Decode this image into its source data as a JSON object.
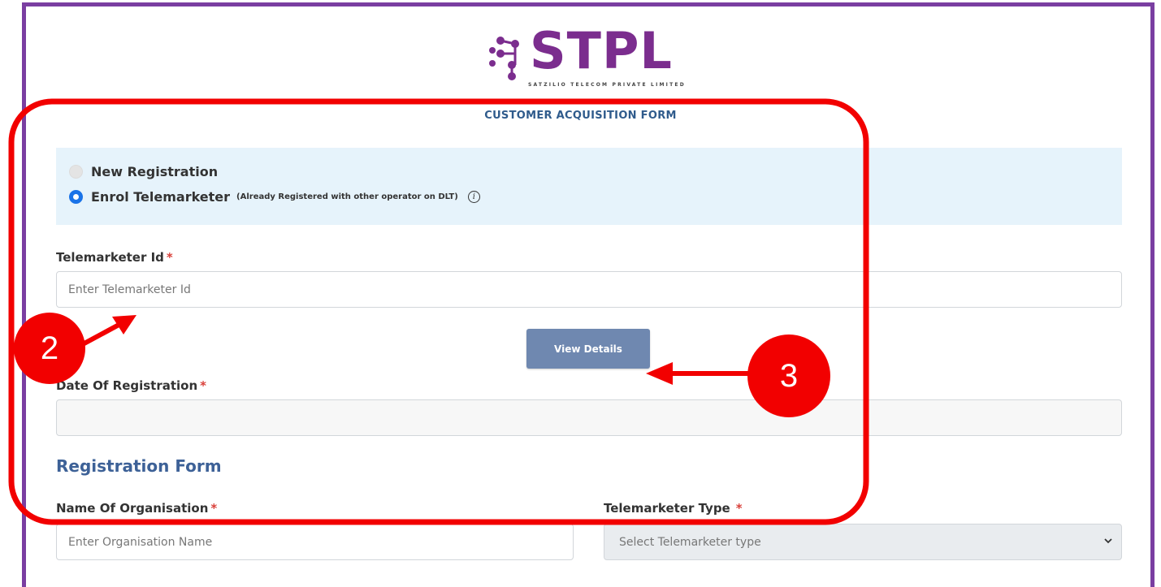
{
  "logo": {
    "brand": "STPL",
    "tagline": "SATZILIO TELECOM PRIVATE LIMITED",
    "brand_color": "#7b2d8e"
  },
  "form_title": "CUSTOMER ACQUISITION FORM",
  "registration_options": [
    {
      "label": "New Registration",
      "selected": false
    },
    {
      "label": "Enrol Telemarketer",
      "note": "(Already Registered with other operator on DLT)",
      "selected": true
    }
  ],
  "fields": {
    "telemarketer_id": {
      "label": "Telemarketer Id",
      "required": "*",
      "placeholder": "Enter Telemarketer Id"
    },
    "date_of_registration": {
      "label": "Date Of Registration",
      "required": "*",
      "value": ""
    },
    "name_of_organisation": {
      "label": "Name Of Organisation",
      "required": "*",
      "placeholder": "Enter Organisation Name"
    },
    "telemarketer_type": {
      "label": "Telemarketer Type",
      "required": "*",
      "selected": "Select Telemarketer type"
    }
  },
  "view_details_label": "View Details",
  "section_title": "Registration Form",
  "annotations": [
    {
      "number": "2"
    },
    {
      "number": "3"
    }
  ],
  "colors": {
    "frame": "#7a3ea1",
    "annotation": "#f20000",
    "button": "#6f88b0",
    "title": "#2f5b8c",
    "highlight_box": "#e6f3fb"
  }
}
